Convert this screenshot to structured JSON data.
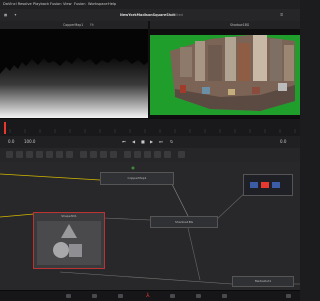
{
  "menu": [
    "DaVinci Resolve",
    "Playback",
    "Fusion",
    "View",
    "Fusion",
    "Workspace",
    "Help"
  ],
  "project_title": "NewYorkMadisonSquareShot",
  "project_status": "Edited",
  "left_viewer": {
    "node": "CopperMap1",
    "zoom": "Fit"
  },
  "right_viewer": {
    "node": "Shadow1BG"
  },
  "transport": {
    "start": "0.0",
    "frame": "100.0",
    "end": "0.0"
  },
  "nodes": {
    "copper_map": "CopperMap1",
    "shape3d": "Shape3D1",
    "shadow": "Shadow1BG",
    "mediaout": "MediaOut1"
  },
  "icons": [
    "node-swap-icon",
    "fusion-page-icon",
    "color-page-icon",
    "fairlight-page-icon",
    "deliver-page-icon",
    "edit-page-icon"
  ],
  "colors": {
    "accent_red": "#e8382f",
    "node_border": "#555555",
    "selection": "#d4b800"
  }
}
